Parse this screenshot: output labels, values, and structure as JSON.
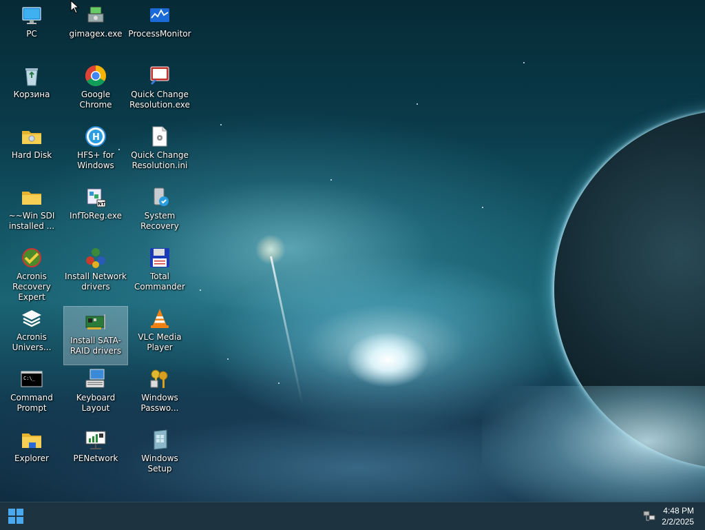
{
  "desktop": {
    "icons": [
      {
        "label": "PC",
        "icon": "monitor-icon"
      },
      {
        "label": "Корзина",
        "icon": "recycle-bin-icon"
      },
      {
        "label": "Hard Disk",
        "icon": "folder-icon"
      },
      {
        "label": "~~Win SDI installed ...",
        "icon": "folder-icon"
      },
      {
        "label": "Acronis Recovery Expert",
        "icon": "acronis-recovery-icon"
      },
      {
        "label": "Acronis Univers...",
        "icon": "acronis-layers-icon"
      },
      {
        "label": "Command Prompt",
        "icon": "cmd-icon"
      },
      {
        "label": "Explorer",
        "icon": "explorer-folder-icon"
      },
      {
        "label": "gimagex.exe",
        "icon": "gimagex-icon"
      },
      {
        "label": "Google Chrome",
        "icon": "chrome-icon"
      },
      {
        "label": "HFS+ for Windows",
        "icon": "hfs-icon"
      },
      {
        "label": "InfToReg.exe",
        "icon": "inftoreg-icon"
      },
      {
        "label": "Install Network drivers",
        "icon": "network-drivers-icon"
      },
      {
        "label": "Install SATA-RAID drivers",
        "icon": "pci-card-icon"
      },
      {
        "label": "Keyboard Layout",
        "icon": "keyboard-icon"
      },
      {
        "label": "PENetwork",
        "icon": "penetwork-icon"
      },
      {
        "label": "ProcessMonitor",
        "icon": "process-monitor-icon"
      },
      {
        "label": "Quick Change Resolution.exe",
        "icon": "resolution-exe-icon"
      },
      {
        "label": "Quick Change Resolution.ini",
        "icon": "ini-file-icon"
      },
      {
        "label": "System Recovery",
        "icon": "system-recovery-icon"
      },
      {
        "label": "Total Commander",
        "icon": "floppy-icon"
      },
      {
        "label": "VLC Media Player",
        "icon": "vlc-icon"
      },
      {
        "label": "Windows Passwo...",
        "icon": "keys-icon"
      },
      {
        "label": "Windows Setup",
        "icon": "windows-setup-icon"
      }
    ],
    "selected_icon": "Install SATA-RAID drivers"
  },
  "taskbar": {
    "start_icon": "windows-logo-icon",
    "tray_icon": "network-icon",
    "clock": {
      "time": "4:48 PM",
      "date": "2/2/2025"
    }
  },
  "colors": {
    "taskbar": "#1d3340",
    "start_accent": "#4aa8ee"
  }
}
